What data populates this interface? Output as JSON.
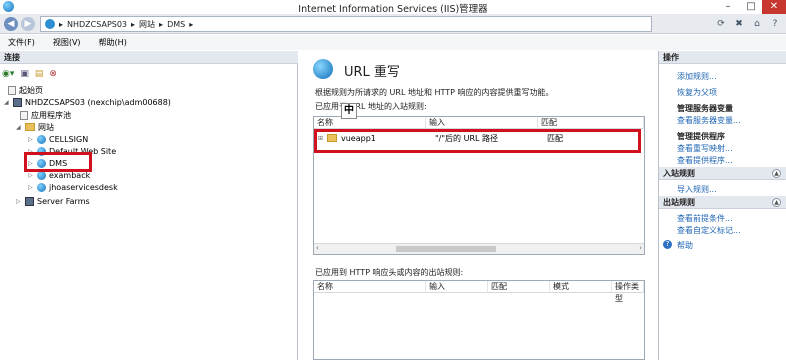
{
  "window": {
    "title": "Internet Information Services (IIS)管理器"
  },
  "address": {
    "segments": [
      "NHDZCSAPS03",
      "▸",
      "网站",
      "▸",
      "DMS",
      "▸"
    ]
  },
  "menu": {
    "items": [
      "文件(F)",
      "视图(V)",
      "帮助(H)"
    ]
  },
  "connections": {
    "header": "连接",
    "tree": [
      {
        "label": "起始页",
        "icon": "start-page-icon",
        "level": 0
      },
      {
        "label": "NHDZCSAPS03 (nexchip\\adm00688)",
        "icon": "server-icon",
        "level": 0
      },
      {
        "label": "应用程序池",
        "icon": "app-pool-icon",
        "level": 1
      },
      {
        "label": "网站",
        "icon": "sites-folder-icon",
        "level": 1
      },
      {
        "label": "CELLSIGN",
        "icon": "globe-icon",
        "level": 2
      },
      {
        "label": "Default Web Site",
        "icon": "globe-icon",
        "level": 2
      },
      {
        "label": "DMS",
        "icon": "globe-icon",
        "level": 2
      },
      {
        "label": "examback",
        "icon": "globe-icon",
        "level": 2
      },
      {
        "label": "jhoaservicesdesk",
        "icon": "globe-icon",
        "level": 2
      },
      {
        "label": "Server Farms",
        "icon": "server-farms-icon",
        "level": 1
      }
    ]
  },
  "feature": {
    "title": "URL 重写",
    "description": "根据规则为所请求的 URL 地址和 HTTP 响应的内容提供重写功能。",
    "inbound_label": "已应用于 URL 地址的入站规则:",
    "tooltip": "中",
    "inbound_columns": [
      "名称",
      "输入",
      "匹配"
    ],
    "inbound_rows": [
      {
        "name": "vueapp1",
        "input": "\"/\"后的 URL 路径",
        "match": "匹配"
      }
    ],
    "outbound_label": "已应用到 HTTP 响应头或内容的出站规则:",
    "outbound_columns": [
      "名称",
      "输入",
      "匹配",
      "模式",
      "操作类型"
    ]
  },
  "actions": {
    "header": "操作",
    "add_rule": "添加规则...",
    "revert": "恢复为父项",
    "server_vars_title": "管理服务器变量",
    "view_server_vars": "查看服务器变量...",
    "providers_title": "管理提供程序",
    "view_rewrite_maps": "查看重写映射...",
    "view_providers": "查看提供程序...",
    "inbound_header": "入站规则",
    "import_rules": "导入规则...",
    "outbound_header": "出站规则",
    "view_preconditions": "查看前提条件...",
    "view_custom_tags": "查看自定义标记...",
    "help": "帮助"
  },
  "colors": {
    "highlight": "#d0101c",
    "link": "#1d64b4"
  }
}
